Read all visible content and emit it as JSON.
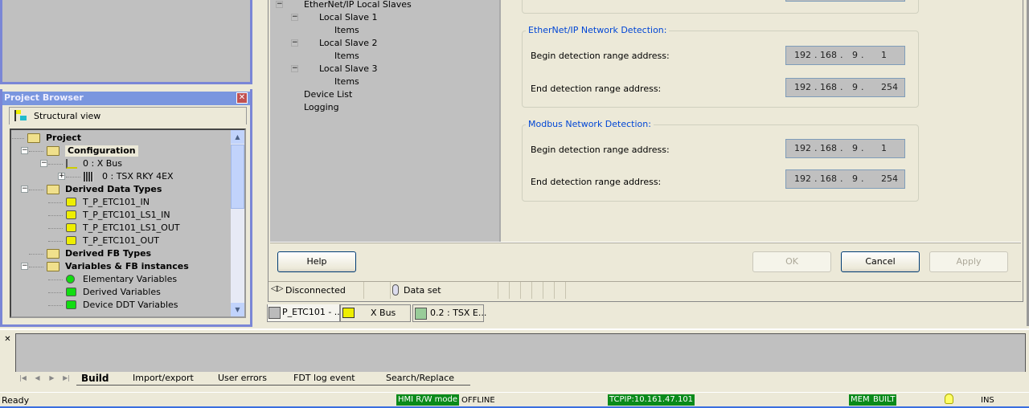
{
  "project_browser": {
    "title": "Project Browser",
    "view_label": "Structural view",
    "tree": [
      {
        "label": "Project",
        "bold": true
      },
      {
        "label": "Configuration",
        "bold": true
      },
      {
        "label": "0 : X Bus"
      },
      {
        "label": "0 : TSX RKY 4EX"
      },
      {
        "label": "Derived Data Types",
        "bold": true
      },
      {
        "label": "T_P_ETC101_IN"
      },
      {
        "label": "T_P_ETC101_LS1_IN"
      },
      {
        "label": "T_P_ETC101_LS1_OUT"
      },
      {
        "label": "T_P_ETC101_OUT"
      },
      {
        "label": "Derived FB Types",
        "bold": true
      },
      {
        "label": "Variables & FB instances",
        "bold": true
      },
      {
        "label": "Elementary Variables"
      },
      {
        "label": "Derived Variables"
      },
      {
        "label": "Device DDT Variables"
      }
    ]
  },
  "config_tree": [
    "EtherNet/IP Local Slaves",
    "Local Slave 1",
    "Items",
    "Local Slave 2",
    "Items",
    "Local Slave 3",
    "Items",
    "Device List",
    "Logging"
  ],
  "ethernet_detection": {
    "title": "EtherNet/IP Network Detection:",
    "begin_label": "Begin detection range address:",
    "begin": [
      "192",
      "168",
      "9",
      "1"
    ],
    "end_label": "End detection range address:",
    "end": [
      "192",
      "168",
      "9",
      "254"
    ]
  },
  "modbus_detection": {
    "title": "Modbus Network Detection:",
    "begin_label": "Begin detection range address:",
    "begin": [
      "192",
      "168",
      "9",
      "1"
    ],
    "end_label": "End detection range address:",
    "end": [
      "192",
      "168",
      "9",
      "254"
    ]
  },
  "buttons": {
    "help": "Help",
    "ok": "OK",
    "cancel": "Cancel",
    "apply": "Apply"
  },
  "dialog_status": {
    "connection": "Disconnected",
    "dataset": "Data set"
  },
  "doc_tabs": [
    "P_ETC101 - ...",
    "X Bus",
    "0.2 : TSX E..."
  ],
  "output_tabs": [
    "Build",
    "Import/export",
    "User errors",
    "FDT log event",
    "Search/Replace"
  ],
  "statusbar": {
    "ready": "Ready",
    "hmi": "HMI R/W mode",
    "offline": "OFFLINE",
    "tcpip": "TCPIP:10.161.47.101",
    "mem": "MEM",
    "built": "BUILT",
    "ins": "INS"
  },
  "colors": {
    "status_green": "#0a8a1a",
    "panel_title": "#7a96df",
    "group_title": "#0046d5"
  }
}
